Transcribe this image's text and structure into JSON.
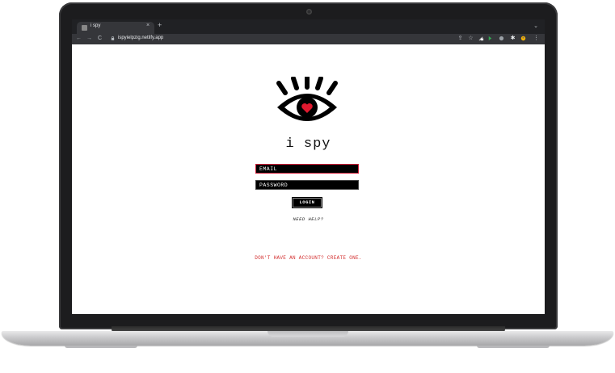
{
  "browser": {
    "tab_title": "i spy",
    "tab_close": "×",
    "new_tab": "+",
    "tab_menu": "⌄",
    "back": "←",
    "forward": "→",
    "reload": "C",
    "lock": "🔒",
    "url": "ispyielpzig.netlify.app",
    "extensions": {
      "share": "⇪",
      "star": "☆",
      "puzzle": "✱",
      "menu": "⋮"
    }
  },
  "app": {
    "title": "i spy",
    "email_placeholder": "EMAIL",
    "password_placeholder": "PASSWORD",
    "login_label": "LOGIN",
    "help_link": "NEED HELP?",
    "signup_link": "DON'T HAVE AN ACCOUNT? CREATE ONE.",
    "colors": {
      "accent": "#d32f2f",
      "field_bg": "#000000",
      "text": "#111111"
    },
    "logo_icon": "eye-logo-icon"
  }
}
